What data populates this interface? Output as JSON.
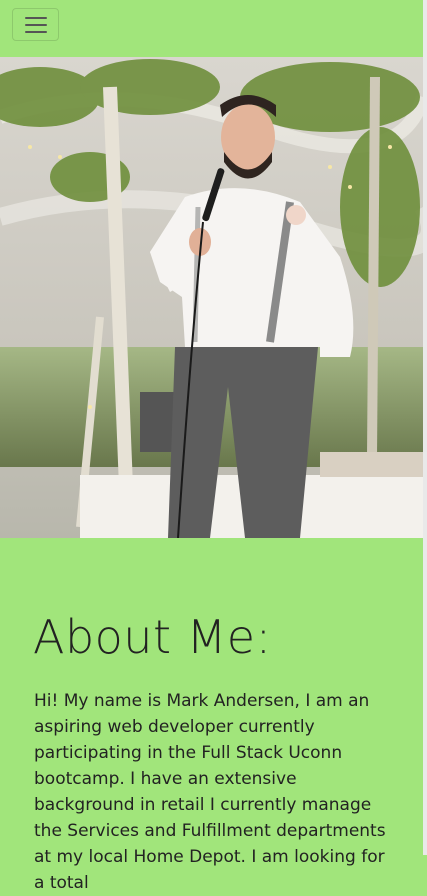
{
  "navbar": {
    "toggle_icon": "hamburger-menu-icon"
  },
  "hero_image": {
    "description_icon": "profile-photo"
  },
  "about": {
    "heading": "About Me:",
    "text": "Hi! My name is Mark Andersen, I am an aspiring web developer currently participating in the Full Stack Uconn bootcamp. I have an extensive background in retail I currently manage the Services and Fulfillment departments at my local Home Depot. I am looking for a total"
  },
  "colors": {
    "background": "#a1e57b"
  }
}
